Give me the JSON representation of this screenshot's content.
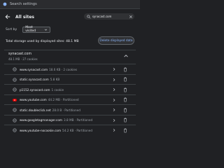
{
  "window": {
    "title": "Search settings"
  },
  "header": {
    "title": "All sites",
    "search_value": "synacast.com"
  },
  "sort": {
    "label": "Sort by",
    "selected": "Most visited"
  },
  "storage": {
    "text": "Total storage used by displayed sites: 48.1 MB",
    "delete_label": "Delete displayed data"
  },
  "group": {
    "name": "synacast.com",
    "info": "48.1 MB · 27 cookies"
  },
  "sites": [
    {
      "domain": "www.synacast.com",
      "detail": "18.6 KB · 2 cookies",
      "favicon": "globe-icon"
    },
    {
      "domain": "static.synacast.com",
      "detail": "5.8 KB",
      "favicon": "globe-icon"
    },
    {
      "domain": "p1152.synacast.com",
      "detail": "1 cookie",
      "favicon": "globe-icon"
    },
    {
      "domain": "www.youtube.com",
      "detail": "44.2 MB · Partitioned",
      "favicon": "youtube-icon"
    },
    {
      "domain": "static.doubleclick.net",
      "detail": "28.0 B · Partitioned",
      "favicon": "globe-icon"
    },
    {
      "domain": "www.googletagmanager.com",
      "detail": "3.8 MB · Partitioned",
      "favicon": "globe-icon"
    },
    {
      "domain": "www.youtube-nocookie.com",
      "detail": "54.2 KB · Partitioned",
      "favicon": "globe-icon"
    }
  ],
  "colors": {
    "accent": "#8ab4f8",
    "youtube": "#ff0000",
    "background": "#202124"
  }
}
